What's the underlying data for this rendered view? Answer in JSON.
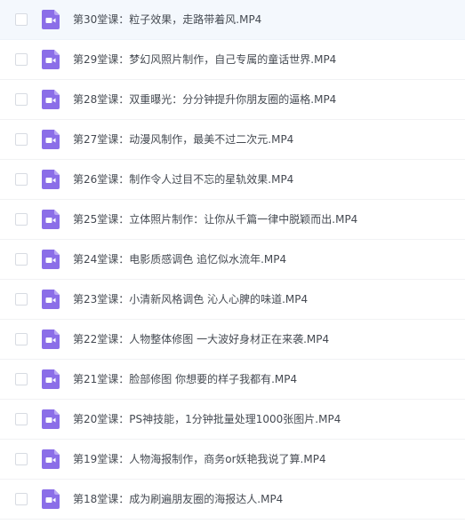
{
  "files": [
    {
      "name": "第30堂课：粒子效果，走路带着风.MP4",
      "icon": "video-file-icon"
    },
    {
      "name": "第29堂课：梦幻风照片制作，自己专属的童话世界.MP4",
      "icon": "video-file-icon"
    },
    {
      "name": "第28堂课：双重曝光：分分钟提升你朋友圈的逼格.MP4",
      "icon": "video-file-icon"
    },
    {
      "name": "第27堂课：动漫风制作，最美不过二次元.MP4",
      "icon": "video-file-icon"
    },
    {
      "name": "第26堂课：制作令人过目不忘的星轨效果.MP4",
      "icon": "video-file-icon"
    },
    {
      "name": "第25堂课：立体照片制作：让你从千篇一律中脱颖而出.MP4",
      "icon": "video-file-icon"
    },
    {
      "name": "第24堂课：电影质感调色 追忆似水流年.MP4",
      "icon": "video-file-icon"
    },
    {
      "name": "第23堂课：小清新风格调色 沁人心脾的味道.MP4",
      "icon": "video-file-icon"
    },
    {
      "name": "第22堂课：人物整体修图 一大波好身材正在来袭.MP4",
      "icon": "video-file-icon"
    },
    {
      "name": "第21堂课：脸部修图 你想要的样子我都有.MP4",
      "icon": "video-file-icon"
    },
    {
      "name": "第20堂课：PS神技能，1分钟批量处理1000张图片.MP4",
      "icon": "video-file-icon"
    },
    {
      "name": "第19堂课：人物海报制作，商务or妖艳我说了算.MP4",
      "icon": "video-file-icon"
    },
    {
      "name": "第18堂课：成为刷遍朋友圈的海报达人.MP4",
      "icon": "video-file-icon"
    }
  ],
  "colors": {
    "icon_purple": "#8b6ee8",
    "icon_fold": "#b9a6f3",
    "text": "#454a52",
    "highlight_row": "#f4f8fd"
  }
}
